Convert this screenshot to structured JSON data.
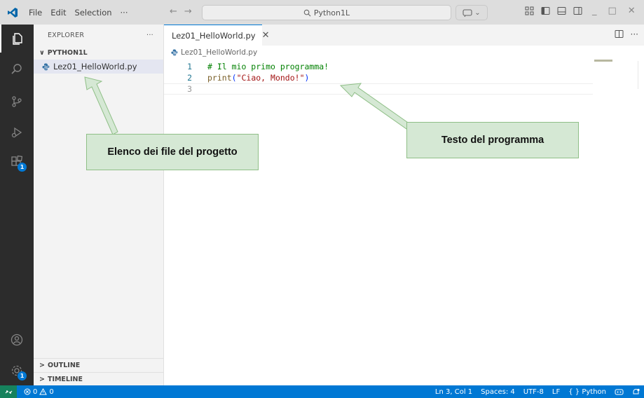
{
  "titlebar": {
    "menu": [
      "File",
      "Edit",
      "Selection",
      "···"
    ],
    "search_text": "Python1L",
    "back_glyph": "←",
    "forward_glyph": "→",
    "copilot_chevron": "⌄",
    "minimize_glyph": "_",
    "maximize_glyph": "□",
    "close_glyph": "✕"
  },
  "activitybar": {
    "extensions_badge": "1",
    "manage_badge": "1"
  },
  "sidebar": {
    "header": "EXPLORER",
    "header_more": "···",
    "folder": "PYTHON1L",
    "folder_chevron": "∨",
    "files": [
      "Lez01_HelloWorld.py"
    ],
    "outline": "OUTLINE",
    "timeline": "TIMELINE",
    "section_chevron": ">"
  },
  "editor": {
    "tab_label": "Lez01_HelloWorld.py",
    "tab_close": "✕",
    "breadcrumb": "Lez01_HelloWorld.py",
    "more_actions": "···",
    "lines": [
      {
        "num": "1",
        "text": "# Il mio primo programma!"
      },
      {
        "num": "2",
        "text_fn": "print",
        "text_open": "(",
        "text_str": "\"Ciao, Mondo!\"",
        "text_close": ")"
      },
      {
        "num": "3",
        "text": ""
      }
    ]
  },
  "annotations": {
    "files_label": "Elenco dei file del progetto",
    "code_label": "Testo del programma"
  },
  "statusbar": {
    "errors": "0",
    "warnings": "0",
    "position": "Ln 3, Col 1",
    "spaces": "Spaces: 4",
    "encoding": "UTF-8",
    "eol": "LF",
    "language_braces": "{ }",
    "language": "Python"
  },
  "colors": {
    "accent": "#0078d4",
    "annotation_fill": "#d5e8d4",
    "annotation_border": "#8fbf87",
    "comment": "#008000",
    "string": "#a31515",
    "function": "#795e26"
  }
}
